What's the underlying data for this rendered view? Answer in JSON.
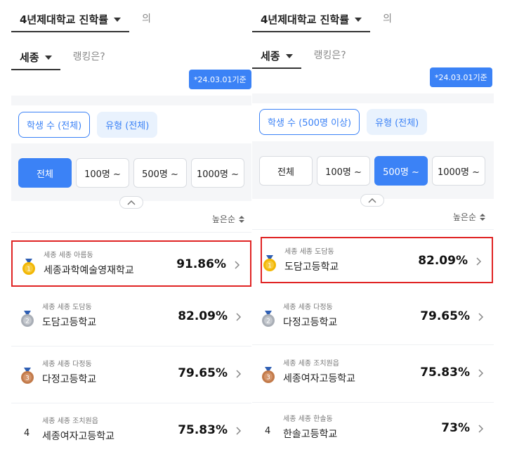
{
  "left": {
    "dropdown1": "4년제대학교 진학률",
    "suffix1": "의",
    "dropdown2": "세종",
    "suffix2": "랭킹은?",
    "date_badge": "*24.03.01기준",
    "chip1": "학생 수 (전체)",
    "chip2": "유형 (전체)",
    "segments": [
      "전체",
      "100명 ~",
      "500명 ~",
      "1000명 ~"
    ],
    "active_segment": 0,
    "sort_label": "높은순",
    "items": [
      {
        "rank": "1",
        "location": "세종 세종 아름동",
        "name": "세종과학예술영재학교",
        "percent": "91.86%"
      },
      {
        "rank": "2",
        "location": "세종 세종 도담동",
        "name": "도담고등학교",
        "percent": "82.09%"
      },
      {
        "rank": "3",
        "location": "세종 세종 다정동",
        "name": "다정고등학교",
        "percent": "79.65%"
      },
      {
        "rank": "4",
        "location": "세종 세종 조치원읍",
        "name": "세종여자고등학교",
        "percent": "75.83%"
      }
    ]
  },
  "right": {
    "dropdown1": "4년제대학교 진학률",
    "suffix1": "의",
    "dropdown2": "세종",
    "suffix2": "랭킹은?",
    "date_badge": "*24.03.01기준",
    "chip1": "학생 수 (500명 이상)",
    "chip2": "유형 (전체)",
    "segments": [
      "전체",
      "100명 ~",
      "500명 ~",
      "1000명 ~"
    ],
    "active_segment": 2,
    "sort_label": "높은순",
    "items": [
      {
        "rank": "1",
        "location": "세종 세종 도담동",
        "name": "도담고등학교",
        "percent": "82.09%"
      },
      {
        "rank": "2",
        "location": "세종 세종 다정동",
        "name": "다정고등학교",
        "percent": "79.65%"
      },
      {
        "rank": "3",
        "location": "세종 세종 조치원읍",
        "name": "세종여자고등학교",
        "percent": "75.83%"
      },
      {
        "rank": "4",
        "location": "세종 세종 한솔동",
        "name": "한솔고등학교",
        "percent": "73%"
      }
    ]
  },
  "colors": {
    "accent": "#3b82f6",
    "highlight": "#e02424",
    "gold": "#f2b705",
    "silver": "#a9aeb6",
    "bronze": "#c27a4a",
    "ribbon": "#2f5fb3"
  },
  "icons": {
    "medal": "medal-icon",
    "chevron": "chevron-right-icon",
    "collapse": "chevron-up-icon",
    "sort": "sort-icon",
    "caret": "caret-down-icon"
  }
}
